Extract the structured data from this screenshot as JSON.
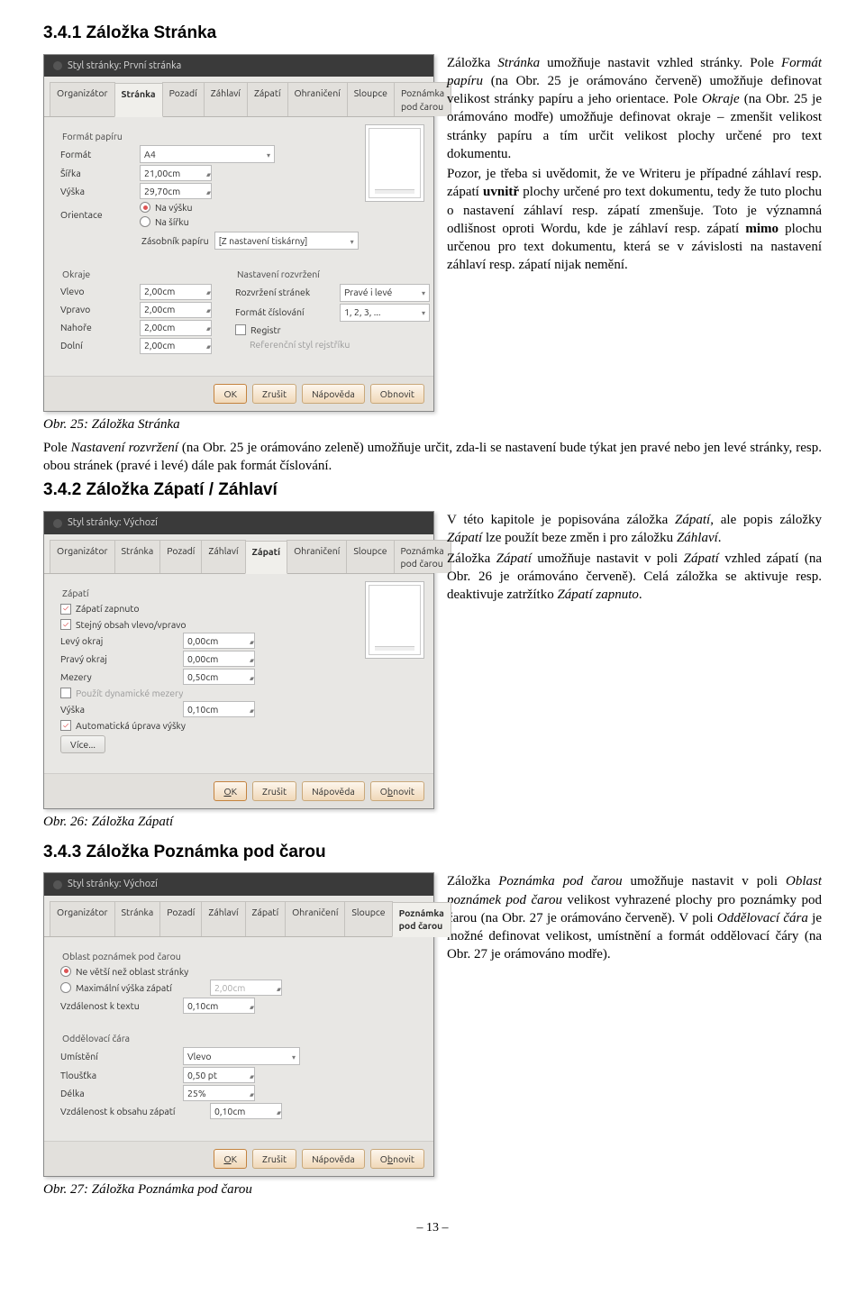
{
  "sections": {
    "s1": "3.4.1 Záložka Stránka",
    "s2": "3.4.2 Záložka Zápatí / Záhlaví",
    "s3": "3.4.3 Záložka Poznámka pod čarou"
  },
  "captions": {
    "c25": "Obr. 25: Záložka Stránka",
    "c26": "Obr. 26: Záložka Zápatí",
    "c27": "Obr. 27: Záložka Poznámka pod čarou"
  },
  "para": {
    "p1a": "Záložka ",
    "p1b": "Stránka",
    "p1c": " umožňuje nastavit vzhled stránky. Pole ",
    "p1d": "Formát papíru",
    "p1e": " (na Obr. 25 je orámováno červeně) umožňuje definovat velikost stránky papíru a jeho orientace. Pole ",
    "p1f": "Okraje",
    "p1g": " (na Obr. 25 je orámováno modře) umožňuje definovat okraje – zmenšit velikost stránky papíru a tím určit velikost plochy určené pro text dokumentu.",
    "p2a": "Pozor, je třeba si uvědomit, že ve Writeru je případné záhlaví resp. zápatí ",
    "p2b": "uvnitř",
    "p2c": " plochy určené pro text dokumentu, tedy že tuto plochu o nastavení záhlaví resp. zápatí zmenšuje. Toto je významná odlišnost oproti Wordu, kde je záhlaví resp. zápatí ",
    "p2d": "mimo",
    "p2e": " plochu určenou pro text dokumentu, která se v závislosti na nastavení záhlaví resp. zápatí nijak nemění.",
    "p3a": "Pole ",
    "p3b": "Nastavení rozvržení",
    "p3c": " (na Obr. 25 je orámováno zeleně) umožňuje určit, zda-li se nastavení bude týkat jen pravé nebo jen levé stránky, resp. obou stránek (pravé i levé) dále pak formát číslování.",
    "p4a": "V této kapitole je popisována záložka ",
    "p4b": "Zápatí",
    "p4c": ", ale popis záložky ",
    "p4d": "Zápatí",
    "p4e": " lze použít beze změn i pro záložku ",
    "p4f": "Záhlaví",
    "p4g": ".",
    "p5a": "Záložka ",
    "p5b": "Zápatí",
    "p5c": " umožňuje nastavit v poli ",
    "p5d": "Zápatí",
    "p5e": " vzhled zápatí (na Obr. 26 je orámováno červeně). Celá záložka se aktivuje resp. deaktivuje zatržítko ",
    "p5f": "Zápatí zapnuto",
    "p5g": ".",
    "p6a": "Záložka ",
    "p6b": "Poznámka pod čarou",
    "p6c": " umožňuje nastavit v poli ",
    "p6d": "Oblast poznámek pod čarou",
    "p6e": " velikost vyhrazené plochy pro poznámky pod čarou (na Obr. 27 je orámováno červeně). V poli ",
    "p6f": "Oddělovací čára",
    "p6g": " je možné definovat velikost, umístnění a formát oddělovací čáry (na Obr. 27 je orámováno modře)."
  },
  "dlg25": {
    "title": "Styl stránky: První stránka",
    "tabs": [
      "Organizátor",
      "Stránka",
      "Pozadí",
      "Záhlaví",
      "Zápatí",
      "Ohraničení",
      "Sloupce",
      "Poznámka pod čarou"
    ],
    "group_paper": "Formát papíru",
    "format_lbl": "Formát",
    "format_val": "A4",
    "width_lbl": "Šířka",
    "width_val": "21,00cm",
    "height_lbl": "Výška",
    "height_val": "29,70cm",
    "orient_lbl": "Orientace",
    "orient_a": "Na výšku",
    "orient_b": "Na šířku",
    "tray_lbl": "Zásobník papíru",
    "tray_val": "[Z nastavení tiskárny]",
    "group_margins": "Okraje",
    "m_left_lbl": "Vlevo",
    "m_right_lbl": "Vpravo",
    "m_top_lbl": "Nahoře",
    "m_bot_lbl": "Dolní",
    "m_val": "2,00cm",
    "group_layout": "Nastavení rozvržení",
    "layout_lbl": "Rozvržení stránek",
    "layout_val": "Pravé i levé",
    "numfmt_lbl": "Formát číslování",
    "numfmt_val": "1, 2, 3, ...",
    "register_lbl": "Registr",
    "refstyle_lbl": "Referenční styl rejstříku",
    "buttons": {
      "ok": "OK",
      "cancel": "Zrušit",
      "help": "Nápověda",
      "reset": "Obnovit"
    }
  },
  "dlg26": {
    "title": "Styl stránky: Výchozí",
    "tabs": [
      "Organizátor",
      "Stránka",
      "Pozadí",
      "Záhlaví",
      "Zápatí",
      "Ohraničení",
      "Sloupce",
      "Poznámka pod čarou"
    ],
    "group": "Zápatí",
    "on_lbl": "Zápatí zapnuto",
    "same_lbl": "Stejný obsah vlevo/vpravo",
    "left_lbl": "Levý okraj",
    "right_lbl": "Pravý okraj",
    "zero": "0,00cm",
    "gap_lbl": "Mezery",
    "gap_val": "0,50cm",
    "dyn_lbl": "Použít dynamické mezery",
    "height_lbl": "Výška",
    "height_val": "0,10cm",
    "auto_lbl": "Automatická úprava výšky",
    "more": "Více...",
    "buttons": {
      "ok": "OK",
      "cancel": "Zrušit",
      "help": "Nápověda",
      "reset": "Obnovit"
    }
  },
  "dlg27": {
    "title": "Styl stránky: Výchozí",
    "tabs": [
      "Organizátor",
      "Stránka",
      "Pozadí",
      "Záhlaví",
      "Zápatí",
      "Ohraničení",
      "Sloupce",
      "Poznámka pod čarou"
    ],
    "group_area": "Oblast poznámek pod čarou",
    "area_a": "Ne větší než oblast stránky",
    "area_b": "Maximální výška zápatí",
    "area_b_val": "2,00cm",
    "dist_lbl": "Vzdálenost k textu",
    "dist_val": "0,10cm",
    "group_line": "Oddělovací čára",
    "pos_lbl": "Umístění",
    "pos_val": "Vlevo",
    "thick_lbl": "Tloušťka",
    "thick_val": "0,50 pt",
    "len_lbl": "Délka",
    "len_val": "25%",
    "gap_lbl": "Vzdálenost k obsahu zápatí",
    "gap_val": "0,10cm",
    "buttons": {
      "ok": "OK",
      "cancel": "Zrušit",
      "help": "Nápověda",
      "reset": "Obnovit"
    }
  },
  "pagenum": "– 13 –"
}
